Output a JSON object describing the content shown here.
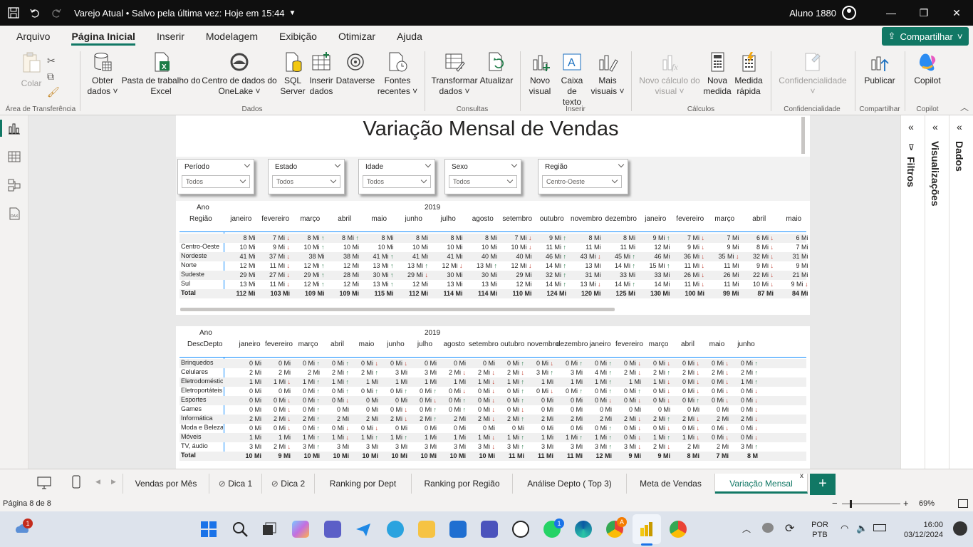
{
  "titlebar": {
    "title": "Varejo Atual • Salvo pela última vez: Hoje em 15:44",
    "user": "Aluno 1880",
    "minimize": "—",
    "maximize": "❐",
    "close": "✕"
  },
  "menu": {
    "items": [
      "Arquivo",
      "Página Inicial",
      "Inserir",
      "Modelagem",
      "Exibição",
      "Otimizar",
      "Ajuda"
    ],
    "share": "Compartilhar"
  },
  "ribbon": {
    "buttons": [
      {
        "label1": "Colar",
        "label2": "",
        "disabled": true
      },
      {
        "label1": "Obter",
        "label2": "dados ˅"
      },
      {
        "label1": "Pasta de trabalho do",
        "label2": "Excel"
      },
      {
        "label1": "Centro de dados do",
        "label2": "OneLake ˅"
      },
      {
        "label1": "SQL",
        "label2": "Server"
      },
      {
        "label1": "Inserir",
        "label2": "dados"
      },
      {
        "label1": "Dataverse",
        "label2": ""
      },
      {
        "label1": "Fontes",
        "label2": "recentes ˅"
      },
      {
        "label1": "Transformar",
        "label2": "dados ˅"
      },
      {
        "label1": "Atualizar",
        "label2": ""
      },
      {
        "label1": "Novo",
        "label2": "visual"
      },
      {
        "label1": "Caixa de",
        "label2": "texto"
      },
      {
        "label1": "Mais",
        "label2": "visuais ˅"
      },
      {
        "label1": "Novo cálculo do",
        "label2": "visual ˅",
        "disabled": true
      },
      {
        "label1": "Nova",
        "label2": "medida"
      },
      {
        "label1": "Medida",
        "label2": "rápida"
      },
      {
        "label1": "Confidencialidade",
        "label2": "˅",
        "disabled": true
      },
      {
        "label1": "Publicar",
        "label2": ""
      },
      {
        "label1": "Copilot",
        "label2": ""
      }
    ],
    "groups": [
      "Área de Transferência",
      "Dados",
      "Consultas",
      "Inserir",
      "Cálculos",
      "Confidencialidade",
      "Compartilhar",
      "Copilot"
    ]
  },
  "report": {
    "title": "Variação Mensal de Vendas",
    "slicers": [
      {
        "title": "Período",
        "value": "Todos"
      },
      {
        "title": "Estado",
        "value": "Todos"
      },
      {
        "title": "Idade",
        "value": "Todos"
      },
      {
        "title": "Sexo",
        "value": "Todos"
      },
      {
        "title": "Região",
        "value": "Centro-Oeste"
      }
    ],
    "matrix1": {
      "corner1": "Ano",
      "corner2": "Região",
      "year": "2019",
      "months": [
        "janeiro",
        "fevereiro",
        "março",
        "abril",
        "maio",
        "junho",
        "julho",
        "agosto",
        "setembro",
        "outubro",
        "novembro",
        "dezembro",
        "janeiro",
        "fevereiro",
        "março",
        "abril",
        "maio"
      ],
      "rows": [
        {
          "label": "",
          "cells": [
            "8 Mi",
            "7 Mi ↓",
            "8 Mi ↑",
            "8 Mi ↑",
            "8 Mi",
            "8 Mi",
            "8 Mi",
            "8 Mi",
            "7 Mi ↓",
            "9 Mi ↑",
            "8 Mi",
            "8 Mi",
            "9 Mi ↑",
            "7 Mi ↓",
            "7 Mi",
            "6 Mi ↓",
            "6 Mi"
          ]
        },
        {
          "label": "Centro-Oeste",
          "cells": [
            "10 Mi",
            "9 Mi ↓",
            "10 Mi ↑",
            "10 Mi",
            "10 Mi",
            "10 Mi",
            "10 Mi",
            "10 Mi",
            "10 Mi ↓",
            "11 Mi ↑",
            "11 Mi",
            "11 Mi",
            "12 Mi",
            "9 Mi ↓",
            "9 Mi",
            "8 Mi ↓",
            "7 Mi"
          ]
        },
        {
          "label": "Nordeste",
          "cells": [
            "41 Mi",
            "37 Mi ↓",
            "38 Mi",
            "38 Mi",
            "41 Mi ↑",
            "41 Mi",
            "41 Mi",
            "40 Mi",
            "40 Mi",
            "46 Mi ↑",
            "43 Mi ↓",
            "45 Mi ↑",
            "46 Mi",
            "36 Mi ↓",
            "35 Mi ↓",
            "32 Mi ↓",
            "31 Mi"
          ]
        },
        {
          "label": "Norte",
          "cells": [
            "12 Mi",
            "11 Mi ↓",
            "12 Mi ↑",
            "12 Mi",
            "13 Mi ↑",
            "13 Mi ↑",
            "12 Mi ↓",
            "13 Mi ↑",
            "12 Mi ↓",
            "14 Mi ↑",
            "13 Mi",
            "14 Mi ↑",
            "15 Mi ↑",
            "11 Mi ↓",
            "11 Mi",
            "9 Mi ↓",
            "9 Mi"
          ]
        },
        {
          "label": "Sudeste",
          "cells": [
            "29 Mi",
            "27 Mi ↓",
            "29 Mi ↑",
            "28 Mi",
            "30 Mi ↑",
            "29 Mi ↓",
            "30 Mi",
            "30 Mi",
            "29 Mi",
            "32 Mi ↑",
            "31 Mi",
            "33 Mi",
            "33 Mi",
            "26 Mi ↓",
            "26 Mi",
            "22 Mi ↓",
            "21 Mi"
          ]
        },
        {
          "label": "Sul",
          "cells": [
            "13 Mi",
            "11 Mi ↓",
            "12 Mi ↑",
            "12 Mi",
            "13 Mi ↑",
            "12 Mi",
            "13 Mi",
            "13 Mi",
            "12 Mi",
            "14 Mi ↑",
            "13 Mi ↓",
            "14 Mi ↑",
            "14 Mi",
            "11 Mi ↓",
            "11 Mi",
            "10 Mi ↓",
            "9 Mi ↓"
          ]
        },
        {
          "label": "Total",
          "cells": [
            "112 Mi",
            "103 Mi",
            "109 Mi",
            "109 Mi",
            "115 Mi",
            "112 Mi",
            "114 Mi",
            "114 Mi",
            "110 Mi",
            "124 Mi",
            "120 Mi",
            "125 Mi",
            "130 Mi",
            "100 Mi",
            "99 Mi",
            "87 Mi",
            "84 Mi"
          ]
        }
      ]
    },
    "matrix2": {
      "corner1": "Ano",
      "corner2": "DescDepto",
      "year": "2019",
      "months": [
        "janeiro",
        "fevereiro",
        "março",
        "abril",
        "maio",
        "junho",
        "julho",
        "agosto",
        "setembro",
        "outubro",
        "novembro",
        "dezembro",
        "janeiro",
        "fevereiro",
        "março",
        "abril",
        "maio",
        "junho"
      ],
      "rows": [
        {
          "label": "Brinquedos",
          "cells": [
            "0 Mi",
            "0 Mi",
            "0 Mi ↑",
            "0 Mi ↑",
            "0 Mi ↓",
            "0 Mi ↓",
            "0 Mi",
            "0 Mi",
            "0 Mi",
            "0 Mi ↑",
            "0 Mi ↓",
            "0 Mi ↑",
            "0 Mi ↑",
            "0 Mi ↓",
            "0 Mi ↓",
            "0 Mi ↓",
            "0 Mi ↓",
            "0 Mi ↑"
          ]
        },
        {
          "label": "Celulares",
          "cells": [
            "2 Mi",
            "2 Mi",
            "2 Mi",
            "2 Mi ↑",
            "2 Mi ↑",
            "3 Mi",
            "3 Mi",
            "2 Mi ↓",
            "2 Mi ↓",
            "2 Mi ↓",
            "3 Mi ↑",
            "3 Mi",
            "4 Mi ↑",
            "2 Mi ↓",
            "2 Mi ↑",
            "2 Mi ↓",
            "2 Mi ↓",
            "2 Mi ↑"
          ]
        },
        {
          "label": "Eletrodomésticos",
          "cells": [
            "1 Mi",
            "1 Mi ↓",
            "1 Mi ↑",
            "1 Mi ↑",
            "1 Mi",
            "1 Mi",
            "1 Mi",
            "1 Mi",
            "1 Mi ↓",
            "1 Mi ↑",
            "1 Mi",
            "1 Mi",
            "1 Mi ↑",
            "1 Mi",
            "1 Mi ↓",
            "0 Mi ↓",
            "0 Mi ↓",
            "1 Mi ↑"
          ]
        },
        {
          "label": "Eletroportáteis",
          "cells": [
            "0 Mi",
            "0 Mi",
            "0 Mi ↑",
            "0 Mi ↑",
            "0 Mi ↑",
            "0 Mi ↑",
            "0 Mi ↑",
            "0 Mi ↓",
            "0 Mi ↓",
            "0 Mi ↑",
            "0 Mi ↓",
            "0 Mi ↑",
            "0 Mi ↑",
            "0 Mi ↑",
            "0 Mi ↓",
            "0 Mi ↓",
            "0 Mi ↓",
            "0 Mi ↓"
          ]
        },
        {
          "label": "Esportes",
          "cells": [
            "0 Mi",
            "0 Mi ↓",
            "0 Mi ↑",
            "0 Mi ↓",
            "0 Mi",
            "0 Mi",
            "0 Mi ↓",
            "0 Mi ↑",
            "0 Mi ↓",
            "0 Mi ↑",
            "0 Mi",
            "0 Mi",
            "0 Mi ↓",
            "0 Mi ↓",
            "0 Mi ↓",
            "0 Mi ↑",
            "0 Mi ↓",
            "0 Mi ↓"
          ]
        },
        {
          "label": "Games",
          "cells": [
            "0 Mi",
            "0 Mi ↓",
            "0 Mi ↑",
            "0 Mi",
            "0 Mi",
            "0 Mi ↓",
            "0 Mi ↑",
            "0 Mi ↑",
            "0 Mi ↓",
            "0 Mi ↓",
            "0 Mi",
            "0 Mi",
            "0 Mi",
            "0 Mi",
            "0 Mi",
            "0 Mi",
            "0 Mi",
            "0 Mi ↓"
          ]
        },
        {
          "label": "Informática",
          "cells": [
            "2 Mi",
            "2 Mi ↓",
            "2 Mi ↑",
            "2 Mi",
            "2 Mi",
            "2 Mi ↓",
            "2 Mi ↑",
            "2 Mi",
            "2 Mi ↓",
            "2 Mi ↑",
            "2 Mi",
            "2 Mi",
            "2 Mi",
            "2 Mi ↓",
            "2 Mi ↑",
            "2 Mi ↓",
            "2 Mi",
            "2 Mi ↓"
          ]
        },
        {
          "label": "Moda e Beleza",
          "cells": [
            "0 Mi",
            "0 Mi ↓",
            "0 Mi ↑",
            "0 Mi ↓",
            "0 Mi ↓",
            "0 Mi",
            "0 Mi",
            "0 Mi",
            "0 Mi",
            "0 Mi",
            "0 Mi",
            "0 Mi",
            "0 Mi ↑",
            "0 Mi ↓",
            "0 Mi ↓",
            "0 Mi ↓",
            "0 Mi ↓",
            "0 Mi ↓"
          ]
        },
        {
          "label": "Móveis",
          "cells": [
            "1 Mi",
            "1 Mi",
            "1 Mi ↑",
            "1 Mi ↓",
            "1 Mi ↑",
            "1 Mi ↑",
            "1 Mi",
            "1 Mi",
            "1 Mi ↓",
            "1 Mi ↑",
            "1 Mi",
            "1 Mi ↑",
            "1 Mi ↑",
            "0 Mi ↓",
            "1 Mi ↑",
            "1 Mi ↓",
            "0 Mi ↓",
            "0 Mi ↓"
          ]
        },
        {
          "label": "TV, áudio",
          "cells": [
            "3 Mi",
            "2 Mi ↓",
            "3 Mi ↑",
            "3 Mi",
            "3 Mi",
            "3 Mi",
            "3 Mi",
            "3 Mi",
            "3 Mi ↓",
            "3 Mi ↑",
            "3 Mi",
            "3 Mi",
            "3 Mi ↑",
            "3 Mi ↓",
            "2 Mi ↓",
            "2 Mi",
            "2 Mi",
            "3 Mi ↑"
          ]
        },
        {
          "label": "Total",
          "cells": [
            "10 Mi",
            "9 Mi",
            "10 Mi",
            "10 Mi",
            "10 Mi",
            "10 Mi",
            "10 Mi",
            "10 Mi",
            "10 Mi",
            "11 Mi",
            "11 Mi",
            "11 Mi",
            "12 Mi",
            "9 Mi",
            "9 Mi",
            "8 Mi",
            "7 Mi",
            "8 M"
          ]
        }
      ]
    }
  },
  "panes": {
    "filters": "Filtros",
    "visualizations": "Visualizações",
    "data": "Dados"
  },
  "tabs": [
    "Vendas por Mês",
    "Dica 1",
    "Dica 2",
    "Ranking por Dept",
    "Ranking por Região",
    "Análise Depto ( Top 3)",
    "Meta de Vendas",
    "Variação Mensal"
  ],
  "status": {
    "page": "Página 8 de 8",
    "zoom": "69%"
  },
  "taskbar": {
    "lang1": "POR",
    "lang2": "PTB",
    "time": "16:00",
    "date": "03/12/2024",
    "weather_badge": "1",
    "whatsapp_badge": "1",
    "chrome_badge": "A"
  },
  "colors": {
    "accent": "#117865",
    "up": "#2e7d4f",
    "down": "#c0392b"
  }
}
